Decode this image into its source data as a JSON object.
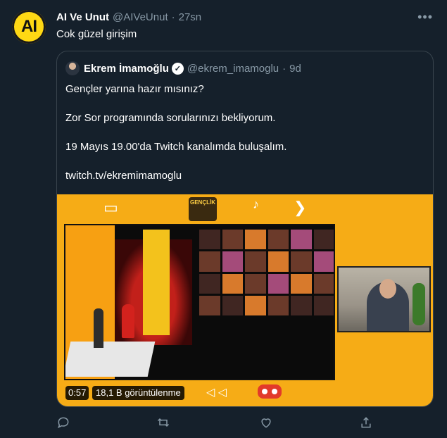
{
  "tweet": {
    "avatar_text": "AI",
    "author_name": "AI Ve Unut",
    "handle": "@AIVeUnut",
    "separator": "·",
    "time": "27sn",
    "more_icon": "more-icon",
    "text": "Cok güzel girişim"
  },
  "quote": {
    "author_name": "Ekrem İmamoğlu",
    "verified_icon": "verified-badge-icon",
    "handle": "@ekrem_imamoglu",
    "separator": "·",
    "time": "9d",
    "lines": [
      "Gençler yarına hazır mısınız?",
      "Zor Sor programında sorularınızı bekliyorum.",
      "19 Mayıs 19.00'da Twitch kanalımda buluşalım.",
      "twitch.tv/ekremimamoglu"
    ],
    "video": {
      "elapsed": "0:57",
      "views": "18,1 B görüntülenme",
      "logo_text": "GENÇLİK"
    }
  },
  "actions": {
    "reply_icon": "reply-icon",
    "retweet_icon": "retweet-icon",
    "like_icon": "heart-icon",
    "share_icon": "share-icon"
  },
  "colors": {
    "background": "#15202b",
    "secondary_text": "#8899a6",
    "border": "#38444d",
    "video_bg": "#f6ac16",
    "avatar_bg": "#ffd814"
  }
}
